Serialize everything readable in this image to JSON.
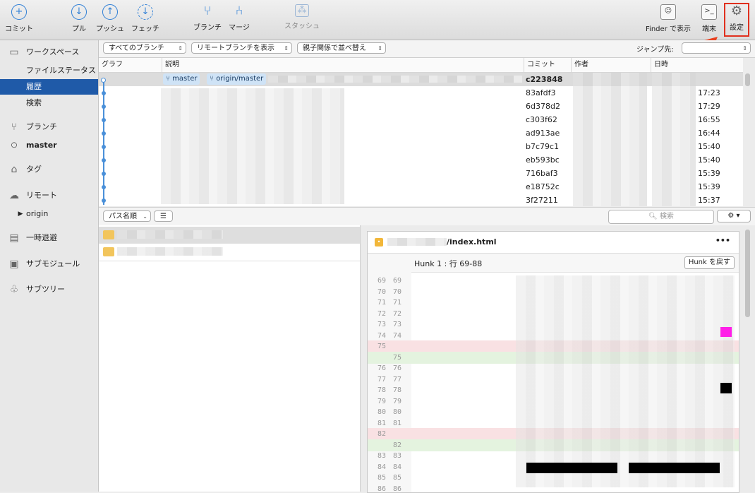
{
  "toolbar": {
    "commit": "コミット",
    "pull": "プル",
    "push": "プッシュ",
    "fetch": "フェッチ",
    "branch": "ブランチ",
    "merge": "マージ",
    "stash": "スタッシュ",
    "finder": "Finder で表示",
    "terminal": "端末",
    "settings": "設定"
  },
  "sidebar": {
    "workspace": "ワークスペース",
    "file_status": "ファイルステータス",
    "history": "履歴",
    "search": "検索",
    "branches": "ブランチ",
    "master": "master",
    "tags": "タグ",
    "remotes": "リモート",
    "origin": "origin",
    "stashes": "一時退避",
    "submodules": "サブモジュール",
    "subtrees": "サブツリー"
  },
  "filters": {
    "branches": "すべてのブランチ",
    "remote": "リモートブランチを表示",
    "order": "親子関係で並べ替え",
    "jump": "ジャンプ先:"
  },
  "table": {
    "headers": [
      "グラフ",
      "説明",
      "コミット",
      "作者",
      "日時"
    ],
    "refs": [
      "master",
      "origin/master"
    ],
    "rows": [
      {
        "hash": "c223848",
        "time": ""
      },
      {
        "hash": "83afdf3",
        "time": "17:23"
      },
      {
        "hash": "6d378d2",
        "time": "17:29"
      },
      {
        "hash": "c303f62",
        "time": "16:55"
      },
      {
        "hash": "ad913ae",
        "time": "16:44"
      },
      {
        "hash": "b7c79c1",
        "time": "15:40"
      },
      {
        "hash": "eb593bc",
        "time": "15:40"
      },
      {
        "hash": "716baf3",
        "time": "15:39"
      },
      {
        "hash": "e18752c",
        "time": "15:39"
      },
      {
        "hash": "3f27211",
        "time": "15:37"
      }
    ]
  },
  "lower": {
    "sort": "パス名順",
    "search_placeholder": "検索"
  },
  "diff": {
    "file": "/index.html",
    "more": "•••",
    "hunk_title": "Hunk 1 : 行 69-88",
    "hunk_revert": "Hunk を戻す",
    "lines": [
      {
        "old": "69",
        "new": "69",
        "kind": "ctx"
      },
      {
        "old": "70",
        "new": "70",
        "kind": "ctx"
      },
      {
        "old": "71",
        "new": "71",
        "kind": "ctx"
      },
      {
        "old": "72",
        "new": "72",
        "kind": "ctx"
      },
      {
        "old": "73",
        "new": "73",
        "kind": "ctx"
      },
      {
        "old": "74",
        "new": "74",
        "kind": "ctx"
      },
      {
        "old": "75",
        "new": "",
        "kind": "del"
      },
      {
        "old": "",
        "new": "75",
        "kind": "add"
      },
      {
        "old": "76",
        "new": "76",
        "kind": "ctx"
      },
      {
        "old": "77",
        "new": "77",
        "kind": "ctx"
      },
      {
        "old": "78",
        "new": "78",
        "kind": "ctx"
      },
      {
        "old": "79",
        "new": "79",
        "kind": "ctx"
      },
      {
        "old": "80",
        "new": "80",
        "kind": "ctx"
      },
      {
        "old": "81",
        "new": "81",
        "kind": "ctx"
      },
      {
        "old": "82",
        "new": "",
        "kind": "del"
      },
      {
        "old": "",
        "new": "82",
        "kind": "add"
      },
      {
        "old": "83",
        "new": "83",
        "kind": "ctx"
      },
      {
        "old": "84",
        "new": "84",
        "kind": "ctx"
      },
      {
        "old": "85",
        "new": "85",
        "kind": "ctx"
      },
      {
        "old": "86",
        "new": "86",
        "kind": "ctx"
      }
    ]
  },
  "colors": {
    "accent": "#2f7fd6",
    "selection": "#1f5aa8",
    "highlight": "#e0301e"
  }
}
